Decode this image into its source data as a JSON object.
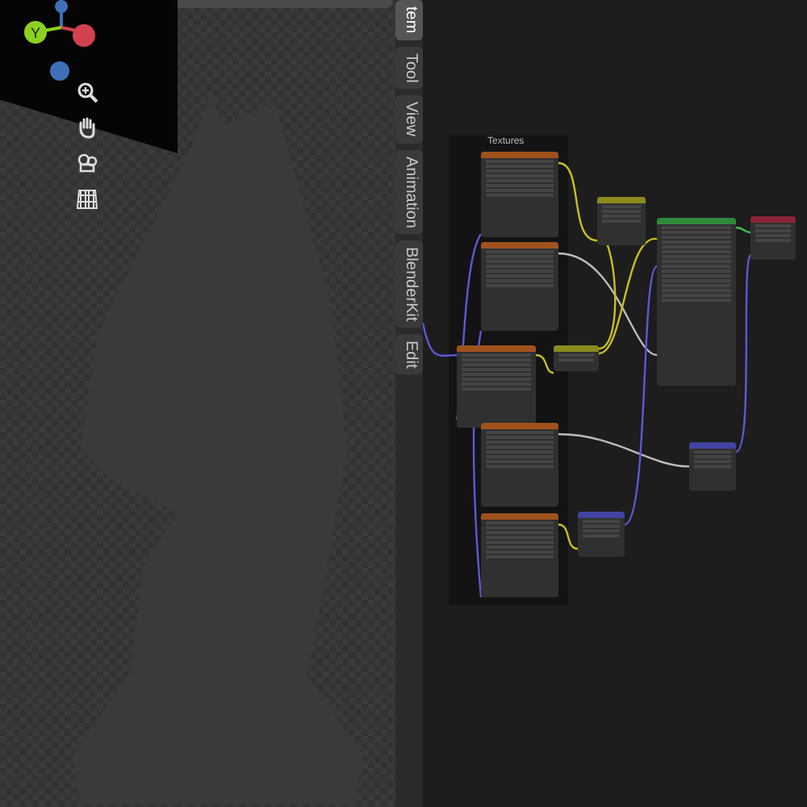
{
  "viewport": {
    "gizmo": {
      "axes": [
        {
          "label": "Y",
          "kind": "y",
          "color": "#8cd11f"
        },
        {
          "kind": "x",
          "color": "#d1414f"
        },
        {
          "kind": "zneg",
          "color": "#3f6fb8"
        },
        {
          "kind": "z",
          "color": "#3f6fb8"
        }
      ]
    }
  },
  "sidebar_tabs": [
    {
      "label": "tem",
      "selected": true
    },
    {
      "label": "Tool",
      "selected": false
    },
    {
      "label": "View",
      "selected": false
    },
    {
      "label": "Animation",
      "selected": false
    },
    {
      "label": "BlenderKit",
      "selected": false
    },
    {
      "label": "Edit",
      "selected": false
    }
  ],
  "node_editor": {
    "frame_label": "Textures",
    "nodes": [
      {
        "color": "#a0521c"
      },
      {
        "color": "#a0521c"
      },
      {
        "color": "#a0521c"
      },
      {
        "color": "#a0521c"
      },
      {
        "color": "#a0521c"
      },
      {
        "color": "#8a8a1e"
      },
      {
        "color": "#8a8a1e"
      },
      {
        "color": "#2e8a3a"
      },
      {
        "color": "#8a2436"
      },
      {
        "color": "#4044a0"
      },
      {
        "color": "#4044a0"
      }
    ]
  }
}
